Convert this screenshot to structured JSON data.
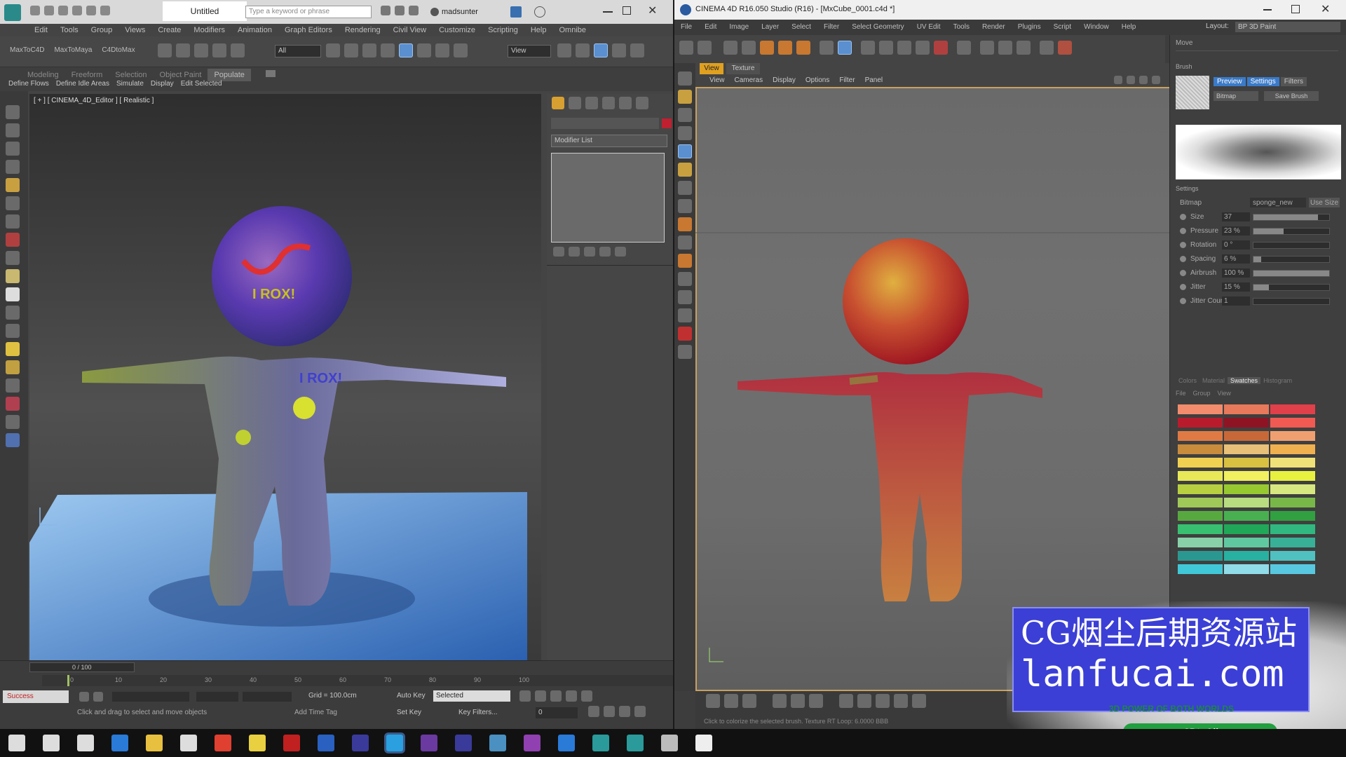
{
  "left_app": {
    "title": "Untitled",
    "search_placeholder": "Type a keyword or phrase",
    "user": "madsunter",
    "menu": [
      "Edit",
      "Tools",
      "Group",
      "Views",
      "Create",
      "Modifiers",
      "Animation",
      "Graph Editors",
      "Rendering",
      "Civil View",
      "Customize",
      "Scripting",
      "Help",
      "Omnibe"
    ],
    "toolbar_labels": [
      "MaxToC4D",
      "MaxToMaya",
      "C4DtoMax"
    ],
    "selection_filter": "All",
    "view_dropdown": "View",
    "ribbon_tabs": [
      "Modeling",
      "Freeform",
      "Selection",
      "Object Paint",
      "Populate"
    ],
    "ribbon_items": [
      "Define Flows",
      "Define Idle Areas",
      "Simulate",
      "Display",
      "Edit Selected"
    ],
    "viewport_label": "[ + ] [ CINEMA_4D_Editor ] [ Realistic ]",
    "modifier_list": "Modifier List",
    "time_slider": "0 / 100",
    "timeline_ticks": [
      "0",
      "10",
      "20",
      "30",
      "40",
      "50",
      "60",
      "70",
      "80",
      "90",
      "100"
    ],
    "status_success": "Success",
    "status_prompt": "Click and drag to select and move objects",
    "add_time_tag": "Add Time Tag",
    "grid": "Grid = 100.0cm",
    "auto_key": "Auto Key",
    "key_mode": "Selected",
    "set_key": "Set Key",
    "key_filters": "Key Filters...",
    "frame": "0"
  },
  "right_app": {
    "title": "CINEMA 4D R16.050 Studio (R16) - [MxCube_0001.c4d *]",
    "menu": [
      "File",
      "Edit",
      "Image",
      "Layer",
      "Select",
      "Filter",
      "Select Geometry",
      "UV Edit",
      "Tools",
      "Render",
      "Plugins",
      "Script",
      "Window",
      "Help"
    ],
    "layout_label": "Layout:",
    "layout_value": "BP 3D Paint",
    "viewport_tabs": [
      "View",
      "Texture"
    ],
    "viewport_menu": [
      "View",
      "Cameras",
      "Display",
      "Options",
      "Filter",
      "Panel"
    ],
    "panel_header": "Move",
    "panel_brush_label": "Brush",
    "brush_tabs": [
      "Preview",
      "Settings",
      "Filters"
    ],
    "brush_preset": "Bitmap",
    "save_brush": "Save Brush",
    "settings_label": "Settings",
    "bitmap_label": "Bitmap",
    "bitmap_value": "sponge_new",
    "use_size": "Use Size",
    "params": [
      {
        "label": "Size",
        "value": "37"
      },
      {
        "label": "Pressure",
        "value": "23 %"
      },
      {
        "label": "Rotation",
        "value": "0 °"
      },
      {
        "label": "Spacing",
        "value": "6 %"
      },
      {
        "label": "Airbrush",
        "value": "100 %"
      },
      {
        "label": "Jitter",
        "value": "15 %"
      },
      {
        "label": "Jitter Count",
        "value": "1"
      }
    ],
    "swatch_tabs": [
      "Colors",
      "Material",
      "Swatches",
      "Histogram"
    ],
    "swatch_menu": [
      "File",
      "Group",
      "View"
    ],
    "status_text": "Click to colorize the selected brush. Texture RT Loop: 6.0000 BBB",
    "watermark_title": "CG烟尘后期资源站",
    "watermark_url": "lanfucai.com",
    "watermark_tag": "3D POWER OF BOTH WORLDS",
    "watermark_site": "www.3DtoAll.com"
  },
  "swatch_colors": [
    "#f28c6c",
    "#e8795a",
    "#e0404a",
    "#b81c2c",
    "#8e1424",
    "#f05a52",
    "#e07a44",
    "#c86838",
    "#f0a070",
    "#c88c3c",
    "#e8c078",
    "#f0b050",
    "#f0d050",
    "#d8c040",
    "#f0e078",
    "#e8e858",
    "#f0f060",
    "#e8f040",
    "#b8d040",
    "#98c830",
    "#d8e880",
    "#a0c858",
    "#b8dc80",
    "#78b848",
    "#58a840",
    "#48b050",
    "#30a040",
    "#38c070",
    "#20a858",
    "#30b880",
    "#88d0a8",
    "#60c8a0",
    "#38b098",
    "#2a9890",
    "#28b0a0",
    "#50c0c0",
    "#40c8d8",
    "#90dce8",
    "#58c8e0"
  ],
  "taskbar_icons": [
    "windows-start",
    "search",
    "task-view",
    "edge",
    "explorer",
    "store",
    "chrome",
    "notes",
    "acrobat",
    "photoshop",
    "c4d",
    "skype",
    "after-effects",
    "c4d-2",
    "app",
    "onenote",
    "edge-2",
    "app-2",
    "app-3",
    "app-4",
    "app-5"
  ]
}
